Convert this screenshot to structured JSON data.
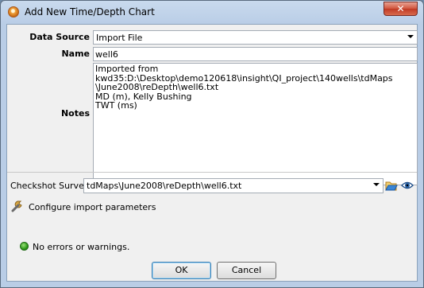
{
  "window": {
    "title": "Add New Time/Depth Chart"
  },
  "form": {
    "data_source": {
      "label": "Data Source",
      "value": "Import File"
    },
    "name": {
      "label": "Name",
      "value": "well6"
    },
    "notes": {
      "label": "Notes",
      "value": "Imported from kwd35:D:\\Desktop\\demo120618\\insight\\QI_project\\140wells\\tdMaps\n\\June2008\\reDepth\\well6.txt\nMD (m), Kelly Bushing\nTWT (ms)"
    },
    "checkshot": {
      "label": "Checkshot Survey",
      "value": "tdMaps\\June2008\\reDepth\\well6.txt"
    },
    "configure_link": "Configure import parameters"
  },
  "status": {
    "text": "No errors or warnings.",
    "color": "#2e9a1a"
  },
  "buttons": {
    "ok": "OK",
    "cancel": "Cancel"
  }
}
